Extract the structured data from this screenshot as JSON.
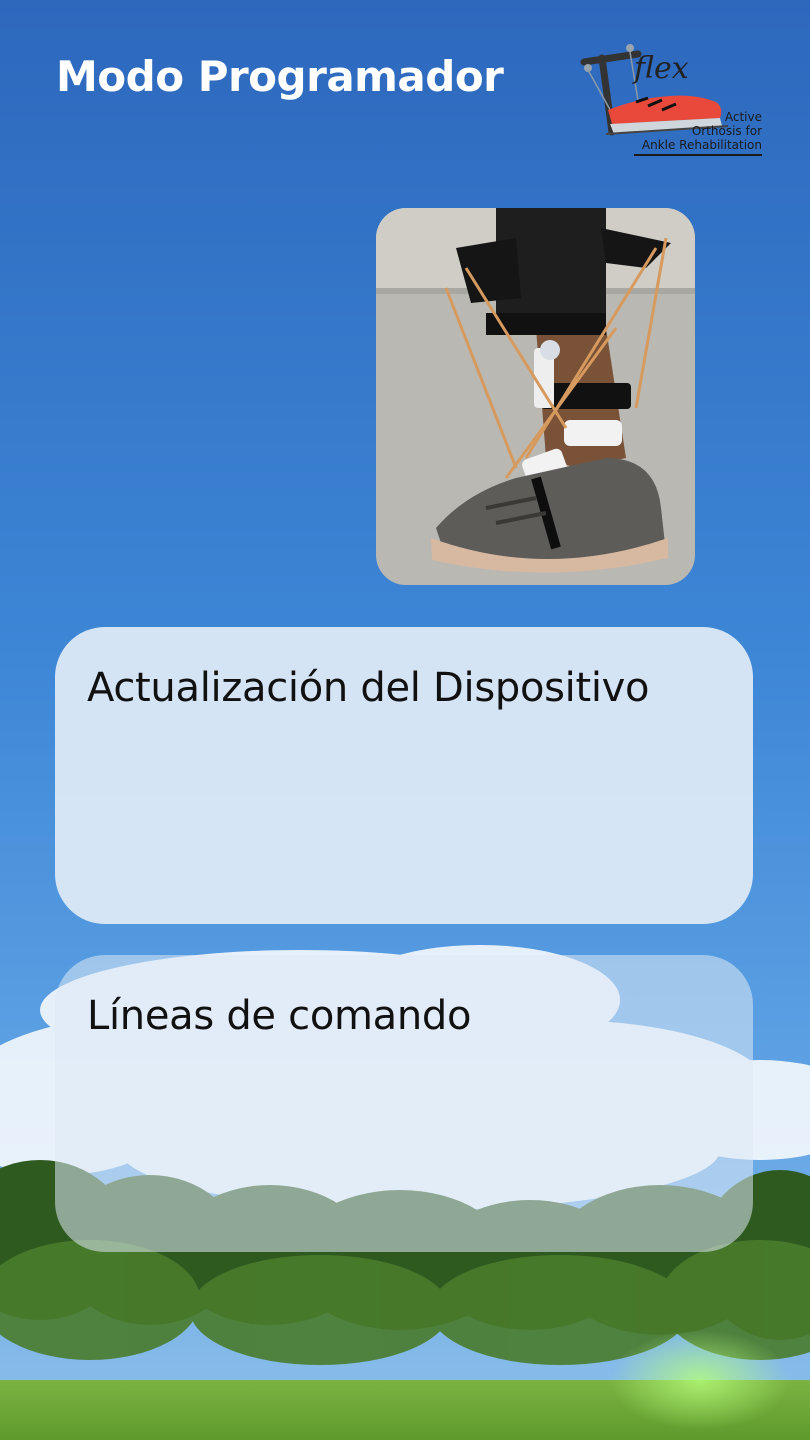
{
  "header": {
    "title": "Modo Programador"
  },
  "logo": {
    "brand": "T-flex",
    "caption": [
      "Active",
      "Orthosis for",
      "Ankle Rehabilitation"
    ],
    "accent_color": "#e8493a"
  },
  "photo": {
    "icon": "ankle-orthosis-photo"
  },
  "cards": {
    "update": {
      "label": "Actualización del Dispositivo"
    },
    "commands": {
      "label": "Líneas de comando"
    }
  },
  "colors": {
    "sky_top": "#2f6fc4",
    "sky_mid": "#4a95e0",
    "grass": "#6fa93a",
    "card": "#dfeaf6"
  }
}
